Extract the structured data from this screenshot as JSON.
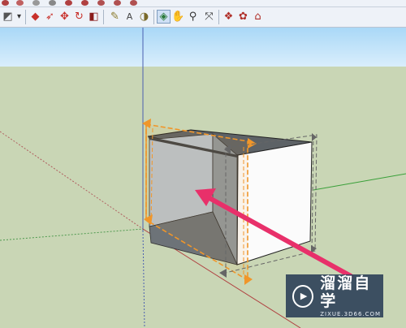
{
  "toolbar": {
    "top_tools": [
      "rectangle-tool",
      "eraser-tool",
      "circle-tool",
      "arc-tool",
      "polygon-tool",
      "freehand-tool",
      "line-tool",
      "pie-tool",
      "rotate-rect-tool"
    ],
    "main_tools": [
      {
        "name": "paint-bucket-tool",
        "glyph": "◩",
        "color": "#555555"
      },
      {
        "name": "dropdown-arrow",
        "glyph": "▾",
        "color": "#333333"
      },
      {
        "name": "push-pull-tool",
        "glyph": "◆",
        "color": "#c8302a"
      },
      {
        "name": "follow-me-tool",
        "glyph": "➶",
        "color": "#c8302a"
      },
      {
        "name": "move-tool",
        "glyph": "✥",
        "color": "#c8302a"
      },
      {
        "name": "rotate-tool",
        "glyph": "↻",
        "color": "#c8302a"
      },
      {
        "name": "scale-tool",
        "glyph": "◧",
        "color": "#8a1c1c"
      },
      {
        "name": "tape-measure-tool",
        "glyph": "✎",
        "color": "#8a7a2a"
      },
      {
        "name": "text-tool",
        "glyph": "A",
        "color": "#444444"
      },
      {
        "name": "protractor-tool",
        "glyph": "◑",
        "color": "#7a6a2a"
      },
      {
        "name": "orbit-tool",
        "glyph": "◈",
        "color": "#2a7a3a",
        "active": true
      },
      {
        "name": "pan-tool",
        "glyph": "✋",
        "color": "#b08050"
      },
      {
        "name": "zoom-tool",
        "glyph": "⚲",
        "color": "#333333"
      },
      {
        "name": "zoom-extents-tool",
        "glyph": "⤧",
        "color": "#333333"
      },
      {
        "name": "components-tool",
        "glyph": "❖",
        "color": "#b0302a"
      },
      {
        "name": "materials-tool",
        "glyph": "✿",
        "color": "#b0302a"
      },
      {
        "name": "warehouse-tool",
        "glyph": "⌂",
        "color": "#b0302a"
      }
    ]
  },
  "viewport": {
    "sky_color": "#bfe3fb",
    "ground_color": "#c9d6b5"
  },
  "watermark": {
    "title": "溜溜自学",
    "url": "ZIXUE.3D66.COM"
  }
}
